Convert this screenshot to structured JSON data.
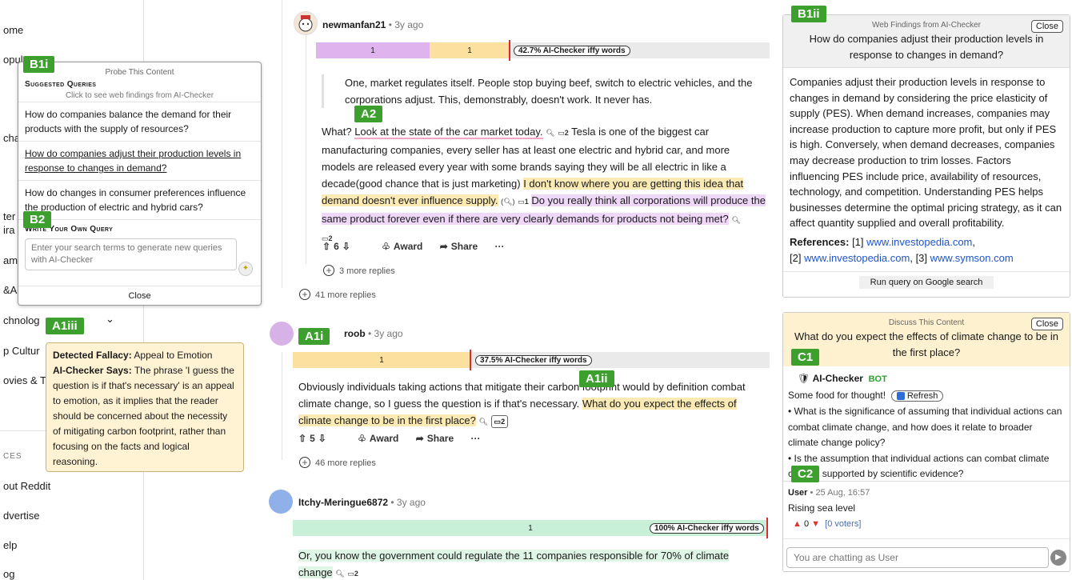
{
  "sidebar": {
    "items": [
      "ome",
      "opul",
      "cha",
      "ter",
      "ira",
      "am",
      "&A",
      "chnolog",
      "p Cultur",
      "ovies & T"
    ],
    "section": "CES",
    "footer_items": [
      "out Reddit",
      "dvertise",
      "elp",
      "og"
    ]
  },
  "tags": {
    "b1i": "B1i",
    "b2": "B2",
    "a1iii": "A1iii",
    "a2": "A2",
    "a1i": "A1i",
    "a1ii": "A1ii",
    "b1ii": "B1ii",
    "c1": "C1",
    "c2": "C2"
  },
  "probe": {
    "title": "Probe This Content",
    "suggested_heading": "Suggested Queries",
    "suggested_sub": "Click to see web findings from AI-Checker",
    "queries": [
      "How do companies balance the demand for their products with the supply of resources?",
      "How do companies adjust their production levels in response to changes in demand?",
      "How do changes in consumer preferences influence the production of electric and hybrid cars?"
    ],
    "own_heading": "Write Your Own Query",
    "input_placeholder": "Enter your search terms to generate new queries with AI-Checker",
    "close": "Close"
  },
  "fallacy": {
    "label1": "Detected Fallacy:",
    "value1": "Appeal to Emotion",
    "label2": "AI-Checker Says:",
    "value2": "The phrase 'I guess the question is if that's necessary' is an appeal to emotion, as it implies that the reader should be concerned about the necessity of mitigating carbon footprint, rather than focusing on the facts and logical reasoning."
  },
  "comment1": {
    "user": "newmanfan21",
    "ago": "• 3y ago",
    "bar_segments": [
      "1",
      "1"
    ],
    "pill": "42.7% AI-Checker iffy words",
    "quote": "One, market regulates itself. People stop buying beef, switch to electric vehicles, and the corporations adjust. This, demonstrably, doesn't work. It never has.",
    "t1": "What? ",
    "t2": "Look at the state of the car market today.",
    "c1": "2",
    "t3": " Tesla is one of the biggest car manufacturing companies, every seller has at least one electric and hybrid car, and more models are released every year with some brands saying they will be all electric in like a decade(good chance that is just marketing) ",
    "t4": "I don't know where you are getting this idea that demand doesn't ever influence supply.",
    "c2": "1",
    "t5": "Do you really think all corporations will produce the same product forever even if there are very clearly demands for products not being met?",
    "c3": "2",
    "votes": "6",
    "award": "Award",
    "share": "Share",
    "more": "···",
    "replies": "3 more replies"
  },
  "more_replies_top": "41 more replies",
  "comment2": {
    "user": "roob",
    "ago": "• 3y ago",
    "bar_segments": [
      "1"
    ],
    "pill": "37.5% AI-Checker iffy words",
    "t1": "Obviously individuals taking actions that mitigate their carbon footprint would by definition combat climate change, so I guess the question is if that's necessary. ",
    "t2": "What do you expect the effects of climate change to be in the first place?",
    "c1": "2",
    "votes": "5",
    "award": "Award",
    "share": "Share",
    "more": "···",
    "replies": "46 more replies"
  },
  "comment3": {
    "user": "Itchy-Meringue6872",
    "ago": "• 3y ago",
    "bar_segments": [
      "1"
    ],
    "pill": "100% AI-Checker iffy words",
    "t1": "Or, you know the government could regulate the 11 companies responsible for 70% of climate change",
    "c1": "2"
  },
  "web": {
    "title": "Web Findings from AI-Checker",
    "close": "Close",
    "question": "How do companies adjust their production levels in response to changes in demand?",
    "body": "Companies adjust their production levels in response to changes in demand by considering the price elasticity of supply (PES). When demand increases, companies may increase production to capture more profit, but only if PES is high. Conversely, when demand decreases, companies may decrease production to trim losses. Factors influencing PES include price, availability of resources, technology, and competition. Understanding PES helps businesses determine the optimal pricing strategy, as it can affect quantity supplied and overall profitability.",
    "refs_label": "References:",
    "ref1_num": "[1]",
    "ref1": "www.investopedia.com",
    "ref2_num": "[2]",
    "ref2": "www.investopedia.com",
    "ref3_num": "[3]",
    "ref3": "www.symson.com",
    "run": "Run query on Google search"
  },
  "discuss": {
    "title": "Discuss This Content",
    "close": "Close",
    "question": "What do you expect the effects of climate change to be in the first place?",
    "bot_name": "AI-Checker",
    "bot_badge": "BOT",
    "food": "Some food for thought!",
    "refresh": "Refresh",
    "bullet1": "• What is the significance of assuming that individual actions can combat climate change, and how does it relate to broader climate change policy?",
    "bullet2": "• Is the assumption that individual actions can combat climate change supported by scientific evidence?",
    "user": "User",
    "time": "• 25 Aug, 16:57",
    "msg": "Rising sea level",
    "vote": "0",
    "voters": "[0 voters]",
    "input_placeholder": "You are chatting as User"
  }
}
